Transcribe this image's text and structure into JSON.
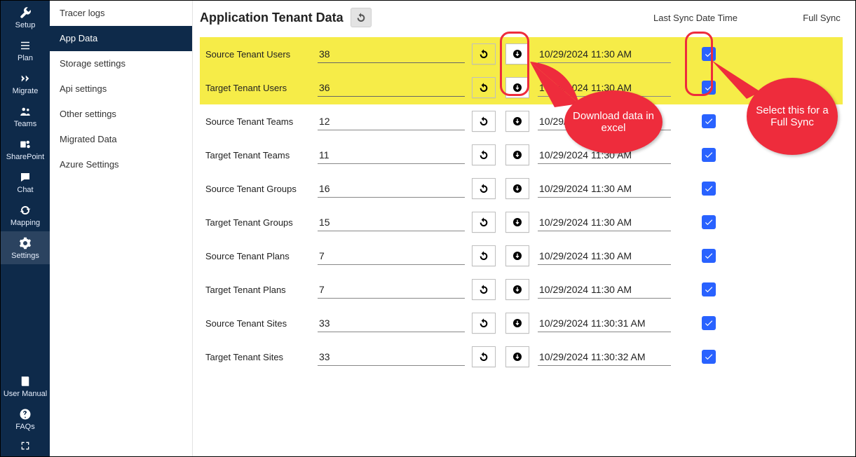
{
  "leftnav": {
    "items": [
      {
        "key": "setup",
        "label": "Setup",
        "icon": "wrench"
      },
      {
        "key": "plan",
        "label": "Plan",
        "icon": "list"
      },
      {
        "key": "migrate",
        "label": "Migrate",
        "icon": "chevrons"
      },
      {
        "key": "teams",
        "label": "Teams",
        "icon": "teams"
      },
      {
        "key": "sharepoint",
        "label": "SharePoint",
        "icon": "sharepoint"
      },
      {
        "key": "chat",
        "label": "Chat",
        "icon": "chat"
      },
      {
        "key": "mapping",
        "label": "Mapping",
        "icon": "sync"
      },
      {
        "key": "settings",
        "label": "Settings",
        "icon": "gear",
        "active": true
      }
    ],
    "bottom": [
      {
        "key": "usermanual",
        "label": "User Manual",
        "icon": "book"
      },
      {
        "key": "faqs",
        "label": "FAQs",
        "icon": "help"
      }
    ]
  },
  "sidebar": {
    "items": [
      {
        "label": "Tracer logs"
      },
      {
        "label": "App Data",
        "active": true
      },
      {
        "label": "Storage settings"
      },
      {
        "label": "Api settings"
      },
      {
        "label": "Other settings"
      },
      {
        "label": "Migrated Data"
      },
      {
        "label": "Azure Settings"
      }
    ]
  },
  "header": {
    "title": "Application Tenant Data",
    "col_lastsync": "Last Sync Date Time",
    "col_fullsync": "Full Sync"
  },
  "rows": [
    {
      "label": "Source Tenant Users",
      "count": "38",
      "date": "10/29/2024 11:30 AM",
      "highlight": true,
      "checked": true
    },
    {
      "label": "Target Tenant Users",
      "count": "36",
      "date": "10/29/2024 11:30 AM",
      "highlight": true,
      "checked": true
    },
    {
      "label": "Source Tenant Teams",
      "count": "12",
      "date": "10/29/2024 11:30 AM",
      "checked": true
    },
    {
      "label": "Target Tenant Teams",
      "count": "11",
      "date": "10/29/2024 11:30 AM",
      "checked": true
    },
    {
      "label": "Source Tenant Groups",
      "count": "16",
      "date": "10/29/2024 11:30 AM",
      "checked": true
    },
    {
      "label": "Target Tenant Groups",
      "count": "15",
      "date": "10/29/2024 11:30 AM",
      "checked": true
    },
    {
      "label": "Source Tenant Plans",
      "count": "7",
      "date": "10/29/2024 11:30 AM",
      "checked": true
    },
    {
      "label": "Target Tenant Plans",
      "count": "7",
      "date": "10/29/2024 11:30 AM",
      "checked": true
    },
    {
      "label": "Source Tenant Sites",
      "count": "33",
      "date": "10/29/2024 11:30:31 AM",
      "checked": true
    },
    {
      "label": "Target Tenant Sites",
      "count": "33",
      "date": "10/29/2024 11:30:32 AM",
      "checked": true
    }
  ],
  "annotations": {
    "download_label": "Download data in excel",
    "fullsync_label": "Select this for a Full Sync"
  }
}
